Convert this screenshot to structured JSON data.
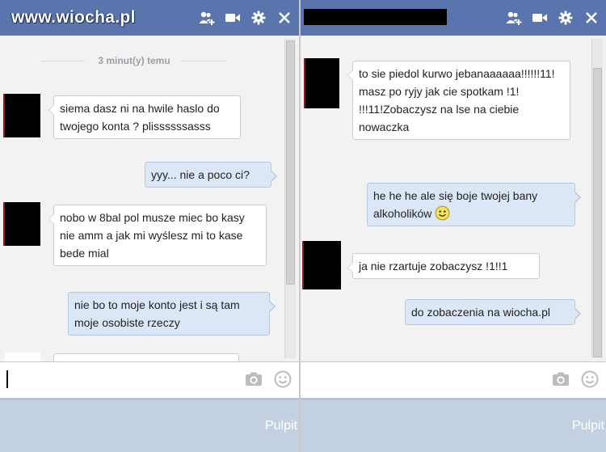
{
  "left_chat": {
    "watermark": "www.wiocha.pl",
    "timestamp": "3 minut(y) temu",
    "messages": [
      {
        "dir": "in",
        "text": "siema dasz ni na hwile haslo do twojego konta ? plissssssasss"
      },
      {
        "dir": "out",
        "text": "yyy... nie a poco ci?"
      },
      {
        "dir": "in",
        "text": "nobo w 8bal pol musze miec bo kasy nie amm a jak mi wyślesz mi to kase bede mial"
      },
      {
        "dir": "out",
        "text": "nie bo to moje konto jest i są tam moje osobiste rzeczy"
      }
    ],
    "taskbar_label": "Pulpit"
  },
  "right_chat": {
    "messages": [
      {
        "dir": "in",
        "text": "to sie piedol kurwo jebanaaaaaa!!!!!!11! masz po ryjy jak cie spotkam !1! !!!11!Zobaczysz na lse na ciebie nowaczka"
      },
      {
        "dir": "out",
        "text": "he he he ale się boje twojej bany alkoholików"
      },
      {
        "dir": "in",
        "text": "ja nie rzartuje zobaczysz !1!!1"
      },
      {
        "dir": "out",
        "text": "do zobaczenia na wiocha.pl"
      }
    ],
    "taskbar_label": "Pulpit"
  },
  "icons": [
    "add-friends-icon",
    "video-call-icon",
    "gear-icon",
    "close-icon",
    "camera-icon",
    "emoticon-icon",
    "smiley-emoji-icon"
  ],
  "colors": {
    "titlebar": "#5a75ad",
    "incoming_bubble": "#ffffff",
    "outgoing_bubble": "#dbe7f7",
    "taskbar": "#c3d0e2"
  }
}
